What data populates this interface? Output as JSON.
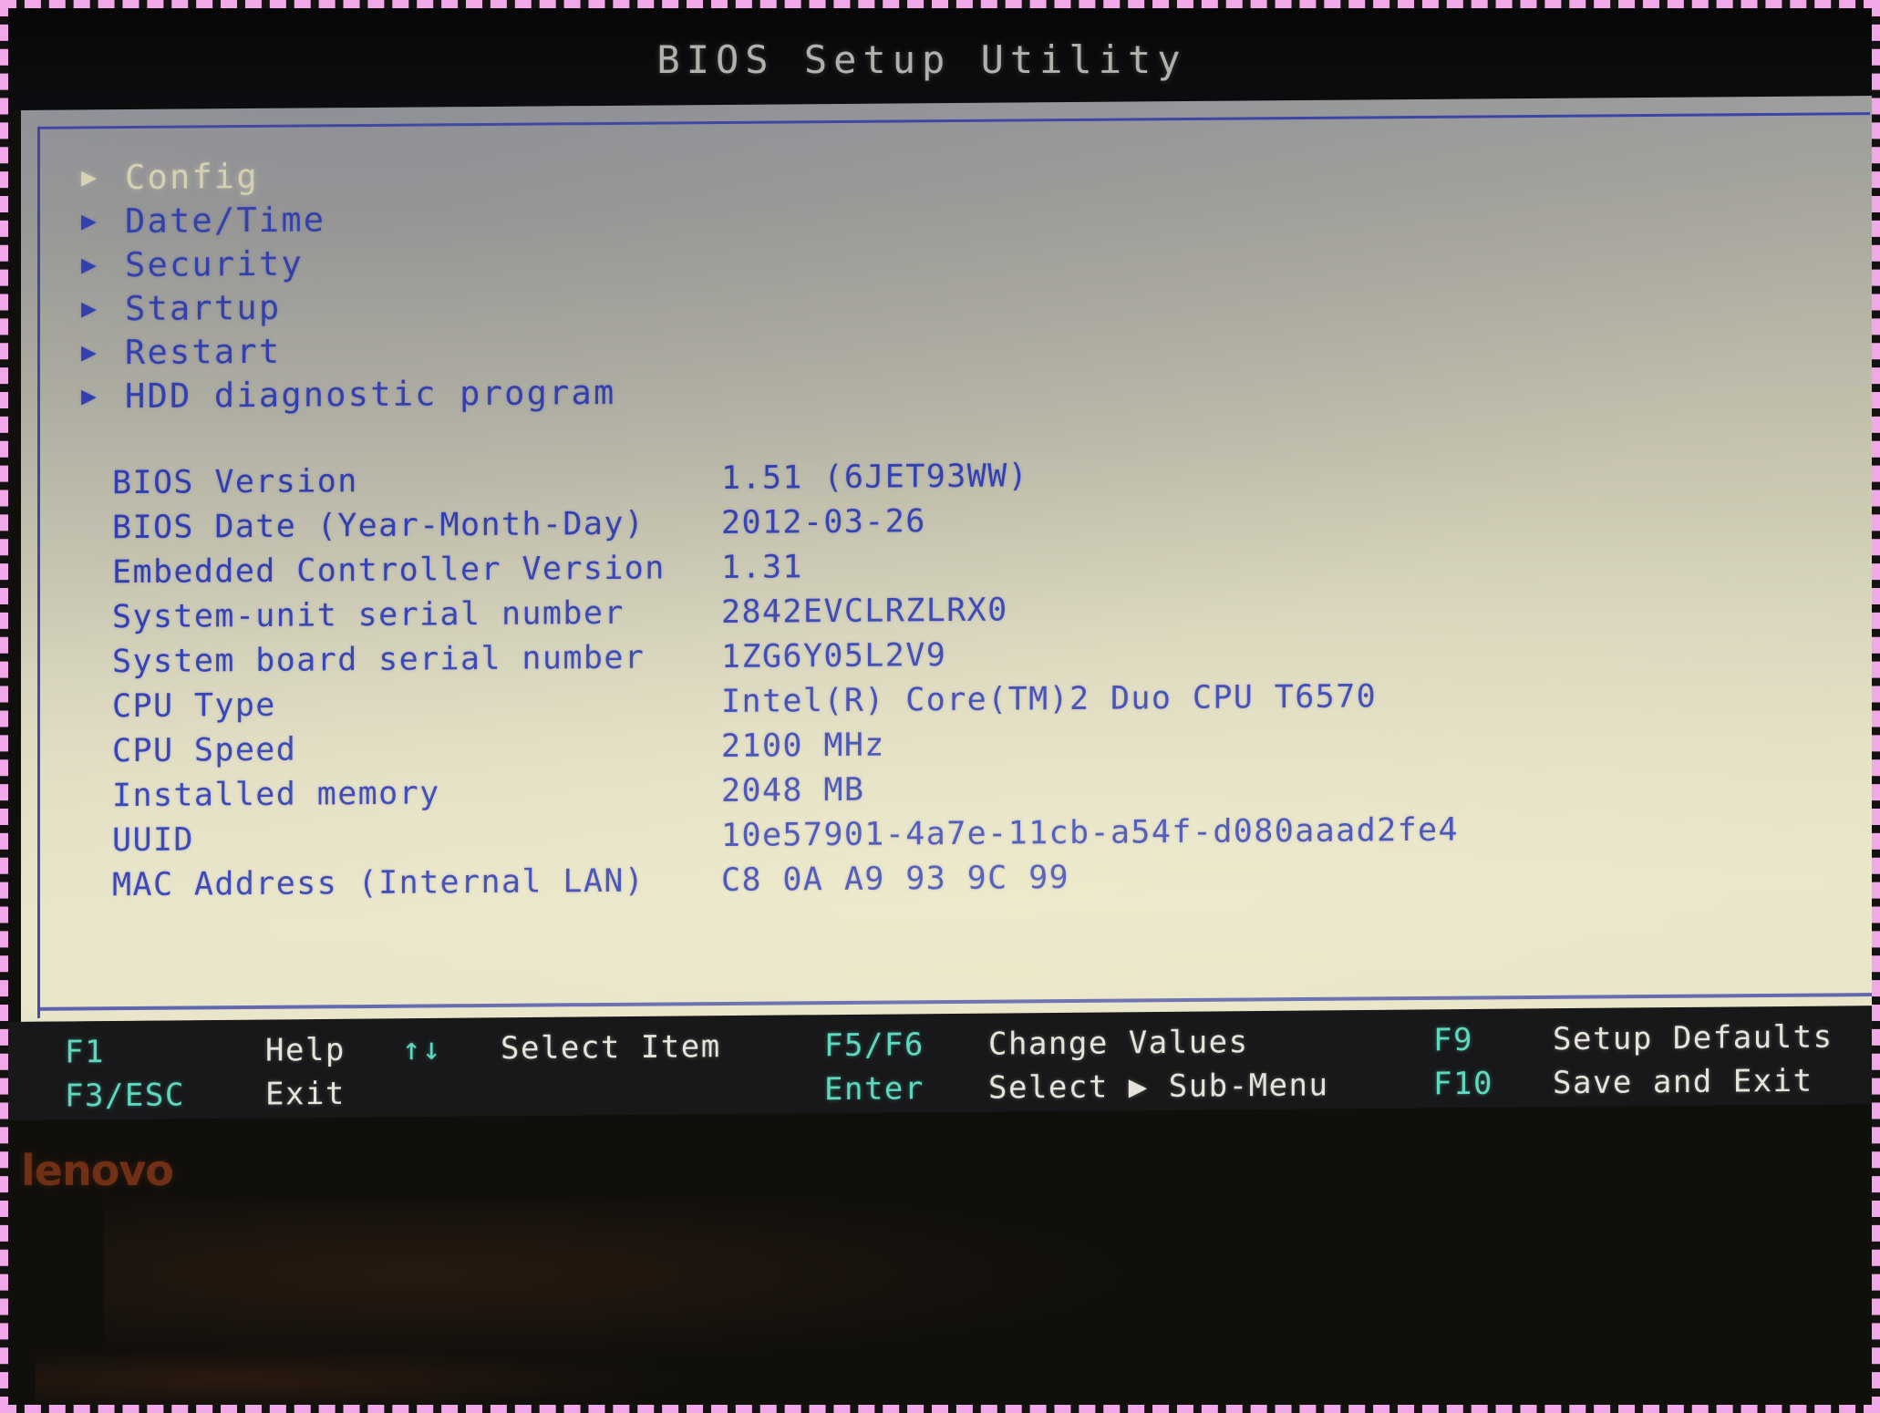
{
  "window": {
    "title": "BIOS Setup Utility",
    "brand_logo": "lenovo"
  },
  "colors": {
    "screen_background_top": "#9a9a9e",
    "screen_background_bottom": "#e8e4ca",
    "text_primary": "#2d3bb5",
    "text_selected": "#efe7bf",
    "panel_border": "#3b44a8",
    "fnbar_background": "#18181a",
    "fnbar_key": "#5fd8c0",
    "fnbar_desc": "#e6e4da",
    "title_text": "#c9c9c2",
    "brand_logo": "#8c3a18",
    "photo_border": "#f0a8e8"
  },
  "menu": {
    "items": [
      {
        "label": "Config",
        "icon": "submenu-arrow-icon",
        "selected": true
      },
      {
        "label": "Date/Time",
        "icon": "submenu-arrow-icon",
        "selected": false
      },
      {
        "label": "Security",
        "icon": "submenu-arrow-icon",
        "selected": false
      },
      {
        "label": "Startup",
        "icon": "submenu-arrow-icon",
        "selected": false
      },
      {
        "label": "Restart",
        "icon": "submenu-arrow-icon",
        "selected": false
      },
      {
        "label": "HDD diagnostic program",
        "icon": "submenu-arrow-icon",
        "selected": false
      }
    ]
  },
  "system_info": {
    "rows": [
      {
        "label": "BIOS Version",
        "value": "1.51   (6JET93WW)"
      },
      {
        "label": "BIOS Date (Year-Month-Day)",
        "value": "2012-03-26"
      },
      {
        "label": "Embedded Controller Version",
        "value": "1.31"
      },
      {
        "label": "System-unit serial number",
        "value": "2842EVCLRZLRX0"
      },
      {
        "label": "System board serial number",
        "value": "1ZG6Y05L2V9"
      },
      {
        "label": "CPU Type",
        "value": "Intel(R) Core(TM)2 Duo CPU T6570"
      },
      {
        "label": "CPU Speed",
        "value": "2100 MHz"
      },
      {
        "label": "Installed memory",
        "value": "2048 MB"
      },
      {
        "label": "UUID",
        "value": "10e57901-4a7e-11cb-a54f-d080aaad2fe4"
      },
      {
        "label": "MAC Address (Internal LAN)",
        "value": "C8 0A A9 93 9C 99"
      }
    ]
  },
  "function_bar": {
    "row1": [
      {
        "key": "F1",
        "desc": "Help"
      },
      {
        "key": "↑↓",
        "desc": "Select Item"
      },
      {
        "key": "F5/F6",
        "desc": "Change Values"
      },
      {
        "key": "F9",
        "desc": "Setup Defaults"
      }
    ],
    "row2": [
      {
        "key": "F3/ESC",
        "desc": "Exit"
      },
      {
        "key": "",
        "desc": ""
      },
      {
        "key": "Enter",
        "desc": "Select ▶ Sub-Menu"
      },
      {
        "key": "F10",
        "desc": "Save and Exit"
      }
    ]
  }
}
